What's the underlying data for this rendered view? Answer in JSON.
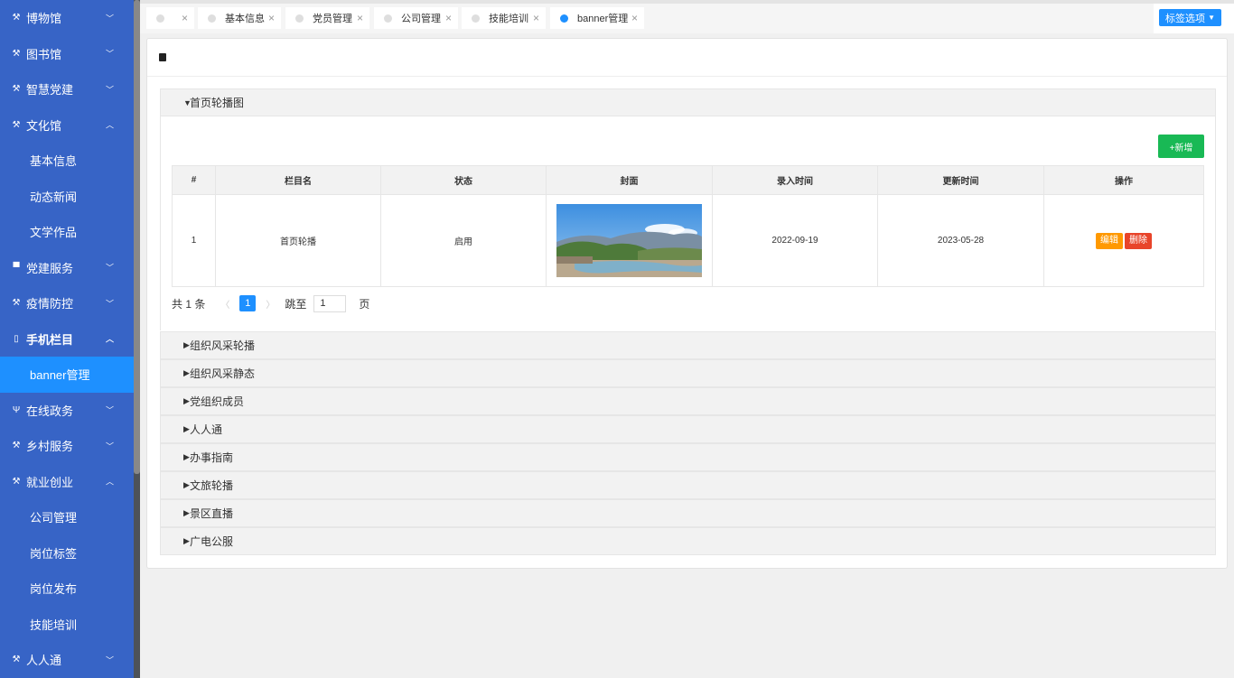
{
  "sidebar": {
    "items": [
      {
        "label": "博物馆",
        "icon": "tools-icon",
        "arrow": "down"
      },
      {
        "label": "图书馆",
        "icon": "tools-icon",
        "arrow": "down"
      },
      {
        "label": "智慧党建",
        "icon": "tools-icon",
        "arrow": "down"
      },
      {
        "label": "文化馆",
        "icon": "tools-icon",
        "arrow": "up"
      },
      {
        "label": "基本信息",
        "sub": true
      },
      {
        "label": "动态新闻",
        "sub": true
      },
      {
        "label": "文学作品",
        "sub": true
      },
      {
        "label": "党建服务",
        "icon": "bus-icon",
        "arrow": "down"
      },
      {
        "label": "疫情防控",
        "icon": "tools-icon",
        "arrow": "down"
      },
      {
        "label": "手机栏目",
        "icon": "mobile-icon",
        "arrow": "up"
      },
      {
        "label": "banner管理",
        "sub": true,
        "active": true
      },
      {
        "label": "在线政务",
        "icon": "fork-icon",
        "arrow": "down"
      },
      {
        "label": "乡村服务",
        "icon": "tools-icon",
        "arrow": "down"
      },
      {
        "label": "就业创业",
        "icon": "tools-icon",
        "arrow": "up"
      },
      {
        "label": "公司管理",
        "sub": true
      },
      {
        "label": "岗位标签",
        "sub": true
      },
      {
        "label": "岗位发布",
        "sub": true
      },
      {
        "label": "技能培训",
        "sub": true
      },
      {
        "label": "人人通",
        "icon": "tools-icon",
        "arrow": "down"
      }
    ]
  },
  "tabs": {
    "items": [
      {
        "label": ""
      },
      {
        "label": "基本信息"
      },
      {
        "label": "党员管理"
      },
      {
        "label": "公司管理"
      },
      {
        "label": "技能培训"
      },
      {
        "label": "banner管理",
        "active": true
      }
    ],
    "close_glyph": "×",
    "options_label": "标签选项"
  },
  "main": {
    "section_open": {
      "title": "首页轮播图",
      "add_button": "+新增",
      "table": {
        "headers": [
          "#",
          "栏目名",
          "状态",
          "封面",
          "录入时间",
          "更新时间",
          "操作"
        ],
        "rows": [
          {
            "index": "1",
            "name": "首页轮播",
            "status": "启用",
            "created": "2022-09-19",
            "updated": "2023-05-28"
          }
        ],
        "edit_label": "编辑",
        "delete_label": "删除"
      },
      "pager": {
        "total_text": "共 1 条",
        "current_page": "1",
        "jump_label": "跳至",
        "jump_value": "1",
        "page_label": "页"
      }
    },
    "sections_collapsed": [
      "组织风采轮播",
      "组织风采静态",
      "党组织成员",
      "人人通",
      "办事指南",
      "文旅轮播",
      "景区直播",
      "广电公服"
    ]
  },
  "colors": {
    "sidebar_bg": "#3764c6",
    "accent_blue": "#1e90ff",
    "add_green": "#19b955",
    "edit_orange": "#ff9900",
    "delete_red": "#e8442a"
  }
}
